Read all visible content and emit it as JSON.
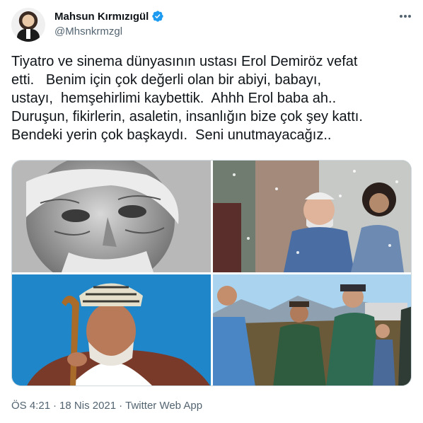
{
  "author": {
    "display_name": "Mahsun Kırmızıgül",
    "handle": "@Mhsnkrmzgl",
    "verified": true,
    "avatar_icon": "avatar"
  },
  "tweet": {
    "text": "Tiyatro ve sinema dünyasının ustası Erol Demiröz vefat\netti.   Benim için çok değerli olan bir abiyi, babayı,\nustayı,  hemşehirlimi kaybettik.  Ahhh Erol baba ah..\nDuruşun, fikirlerin, asaletin, insanlığın bize çok şey kattı.\nBendeki yerin çok başkaydı.  Seni unutmayacağız..",
    "media": [
      {
        "name": "photo-1"
      },
      {
        "name": "photo-2"
      },
      {
        "name": "photo-3"
      },
      {
        "name": "photo-4"
      }
    ],
    "time": "ÖS 4:21",
    "separator": "·",
    "date": "18 Nis 2021",
    "source": "Twitter Web App"
  },
  "colors": {
    "text": "#0f1419",
    "secondary": "#536471",
    "verified": "#1d9bf0"
  },
  "icons": {
    "more": "more-options-icon",
    "verified": "verified-badge-icon"
  }
}
